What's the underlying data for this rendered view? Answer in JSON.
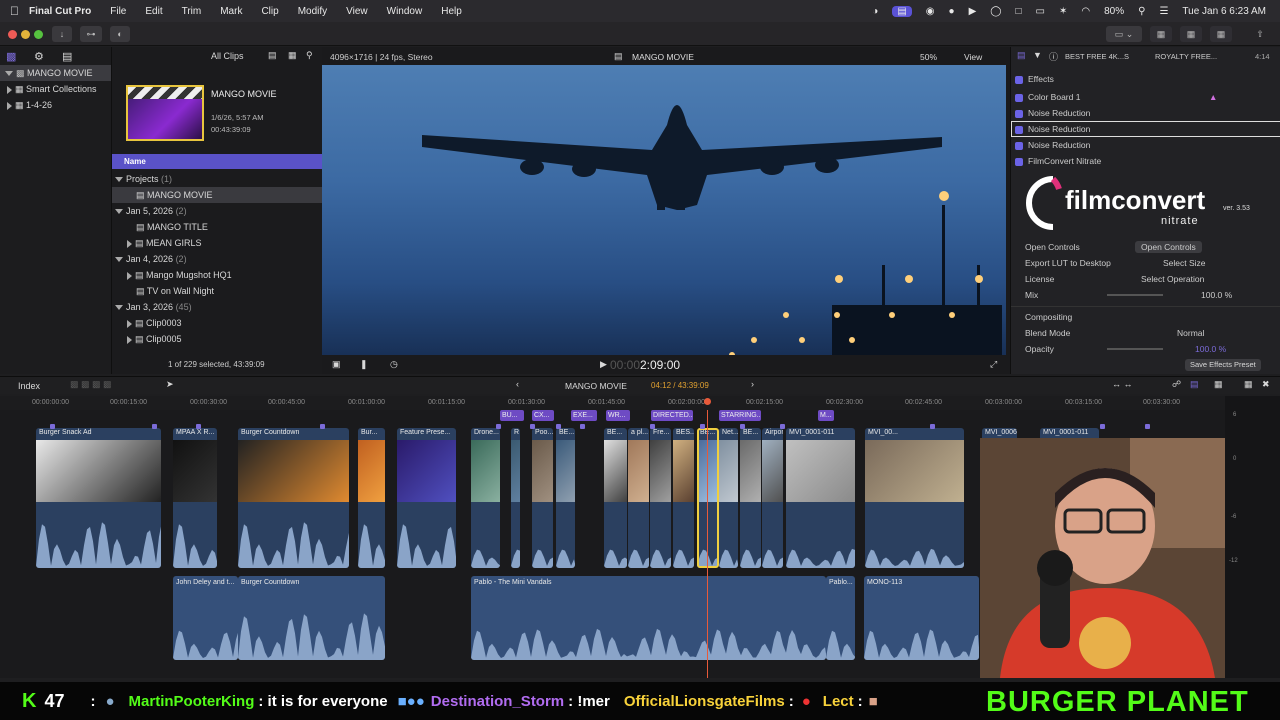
{
  "menubar": {
    "app": "Final Cut Pro",
    "items": [
      "File",
      "Edit",
      "Trim",
      "Mark",
      "Clip",
      "Modify",
      "View",
      "Window",
      "Help"
    ],
    "battery": "80%",
    "clock": "Tue Jan 6  6:23 AM"
  },
  "toolbar": {
    "all_clips": "All Clips"
  },
  "library": {
    "root": "MANGO MOVIE",
    "items": [
      "Smart Collections",
      "1-4-26"
    ]
  },
  "browser": {
    "preview_title": "MANGO MOVIE",
    "preview_date": "1/6/26, 5:57 AM",
    "preview_duration": "00:43:39:09",
    "column_header": "Name",
    "groups": [
      {
        "label": "Projects",
        "count": "(1)"
      },
      {
        "label": "Jan 5, 2026",
        "count": "(2)"
      },
      {
        "label": "Jan 4, 2026",
        "count": "(2)"
      },
      {
        "label": "Jan 3, 2026",
        "count": "(45)"
      }
    ],
    "entries": [
      "MANGO MOVIE",
      "MANGO TITLE",
      "MEAN GIRLS",
      "Mango Mugshot HQ1",
      "TV on Wall Night",
      "Clip0003",
      "Clip0005"
    ],
    "footer": "1 of 229 selected, 43:39:09"
  },
  "viewer": {
    "format": "4096×1716 | 24 fps, Stereo",
    "project": "MANGO MOVIE",
    "zoom": "50%",
    "view_label": "View",
    "timecode_dim": "00:00",
    "timecode": "2:09:00"
  },
  "inspector": {
    "header_left": "BEST FREE 4K...S",
    "header_right": "ROYALTY FREE...",
    "duration": "4:14",
    "effects_label": "Effects",
    "effects": [
      "Color Board 1",
      "Noise Reduction",
      "Noise Reduction",
      "Noise Reduction",
      "FilmConvert Nitrate"
    ],
    "logo_main": "filmconvert",
    "logo_sub": "nitrate",
    "version": "ver. 3.53",
    "params": [
      {
        "label": "Open Controls",
        "value": "Open Controls"
      },
      {
        "label": "Export LUT to Desktop",
        "value": "Select Size"
      },
      {
        "label": "License",
        "value": "Select Operation"
      },
      {
        "label": "Mix",
        "value": "100.0  %"
      }
    ],
    "compositing": "Compositing",
    "blend_label": "Blend Mode",
    "blend_value": "Normal",
    "opacity_label": "Opacity",
    "opacity_value": "100.0  %",
    "save_preset": "Save Effects Preset"
  },
  "timeline_bar": {
    "index": "Index",
    "project": "MANGO MOVIE",
    "position": "04:12 / 43:39:09"
  },
  "ruler": [
    "00:00:00:00",
    "00:00:15:00",
    "00:00:30:00",
    "00:00:45:00",
    "00:01:00:00",
    "00:01:15:00",
    "00:01:30:00",
    "00:01:45:00",
    "00:02:00:00",
    "00:02:15:00",
    "00:02:30:00",
    "00:02:45:00",
    "00:03:00:00",
    "00:03:15:00",
    "00:03:30:00"
  ],
  "titles": [
    "BU...",
    "CX...",
    "EXE...",
    "WR...",
    "DIRECTED...",
    "STARRING...",
    "M..."
  ],
  "video_clips": [
    "Burger Snack Ad",
    "MPAA X R...",
    "Burger Countdown",
    "Bur...",
    "Feature Prese...",
    "Drone...",
    "R",
    "Poo...",
    "BE...",
    "BE...",
    "a pl...",
    "Fre...",
    "BES...",
    "BE...",
    "Net...",
    "BE...",
    "Airport Baggage...",
    "MVI_0001-011",
    "MVI_00...",
    "MVI_0006-010",
    "MVI_0001-011"
  ],
  "audio_clips": [
    "John Deley and t...",
    "Burger Countdown",
    "Pablo - The Mini Vandals",
    "Pablo...",
    "MONO-113",
    "MONO..."
  ],
  "meter_labels": [
    "6",
    "0",
    "-6",
    "-12"
  ],
  "ticker": {
    "k_count": "47",
    "user1": "MartinPooterKing",
    "msg1": ": it is for everyone",
    "user2": "Destination_Storm",
    "msg2": ": !mer",
    "user3": "OfficialLionsgateFilms",
    "msg3": ":",
    "user4": "Lect",
    "msg4": ":",
    "banner": "BURGER PLANET"
  }
}
